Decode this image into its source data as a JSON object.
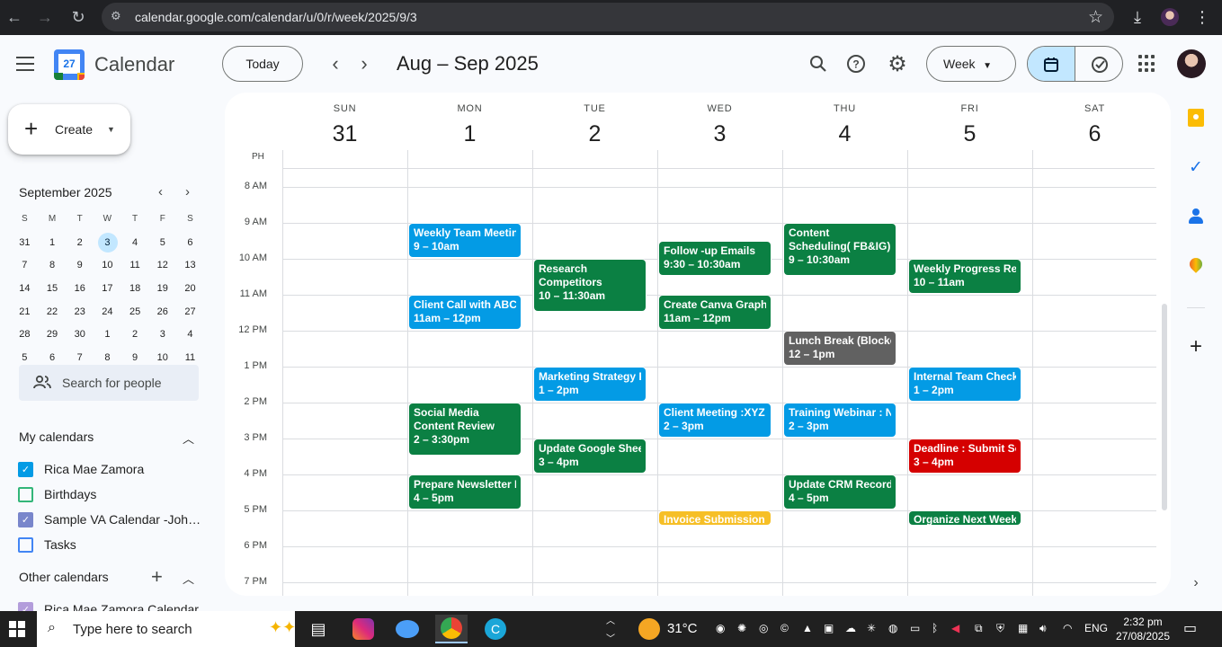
{
  "browser": {
    "url": "calendar.google.com/calendar/u/0/r/week/2025/9/3"
  },
  "header": {
    "app_title": "Calendar",
    "logo_day": "27",
    "today_label": "Today",
    "date_range": "Aug – Sep 2025",
    "view_label": "Week"
  },
  "sidebar": {
    "create_label": "Create",
    "mini_title": "September 2025",
    "mini_days": [
      "S",
      "M",
      "T",
      "W",
      "T",
      "F",
      "S"
    ],
    "mini_weeks": [
      [
        "31",
        "1",
        "2",
        "3",
        "4",
        "5",
        "6"
      ],
      [
        "7",
        "8",
        "9",
        "10",
        "11",
        "12",
        "13"
      ],
      [
        "14",
        "15",
        "16",
        "17",
        "18",
        "19",
        "20"
      ],
      [
        "21",
        "22",
        "23",
        "24",
        "25",
        "26",
        "27"
      ],
      [
        "28",
        "29",
        "30",
        "1",
        "2",
        "3",
        "4"
      ],
      [
        "5",
        "6",
        "7",
        "8",
        "9",
        "10",
        "11"
      ]
    ],
    "search_people_placeholder": "Search for people",
    "my_calendars_title": "My calendars",
    "my_calendars": [
      {
        "name": "Rica Mae Zamora",
        "checked": true,
        "color": "#039be5"
      },
      {
        "name": "Birthdays",
        "checked": false,
        "color": "#33b679"
      },
      {
        "name": "Sample VA Calendar -Johnson",
        "checked": true,
        "color": "#7986cb"
      },
      {
        "name": "Tasks",
        "checked": false,
        "color": "#4285f4"
      }
    ],
    "other_calendars_title": "Other calendars",
    "other_calendars": [
      {
        "name": "Rica Mae Zamora Calendar",
        "checked": true,
        "color": "#b39ddb"
      }
    ]
  },
  "week": {
    "timezone_label": "PH",
    "days": [
      {
        "name": "SUN",
        "num": "31"
      },
      {
        "name": "MON",
        "num": "1"
      },
      {
        "name": "TUE",
        "num": "2"
      },
      {
        "name": "WED",
        "num": "3"
      },
      {
        "name": "THU",
        "num": "4"
      },
      {
        "name": "FRI",
        "num": "5"
      },
      {
        "name": "SAT",
        "num": "6"
      }
    ],
    "hours": [
      "8 AM",
      "9 AM",
      "10 AM",
      "11 AM",
      "12 PM",
      "1 PM",
      "2 PM",
      "3 PM",
      "4 PM",
      "5 PM",
      "6 PM",
      "7 PM"
    ]
  },
  "events": [
    {
      "day": 1,
      "start": 9,
      "end": 10,
      "title": "Weekly Team Meeting",
      "time": "9 – 10am",
      "color": "#039be5"
    },
    {
      "day": 1,
      "start": 11,
      "end": 12,
      "title": "Client Call with ABC Co",
      "time": "11am – 12pm",
      "color": "#039be5"
    },
    {
      "day": 1,
      "start": 14,
      "end": 15.5,
      "title": "Social Media Content Review",
      "time": "2 – 3:30pm",
      "color": "#0b8043",
      "wrap": true
    },
    {
      "day": 1,
      "start": 16,
      "end": 17,
      "title": "Prepare Newsletter Draft",
      "time": "4 – 5pm",
      "color": "#0b8043"
    },
    {
      "day": 2,
      "start": 10,
      "end": 11.5,
      "title": "Research Competitors",
      "time": "10 – 11:30am",
      "color": "#0b8043",
      "wrap": true
    },
    {
      "day": 2,
      "start": 13,
      "end": 14,
      "title": "Marketing Strategy Plan",
      "time": "1 – 2pm",
      "color": "#039be5"
    },
    {
      "day": 2,
      "start": 15,
      "end": 16,
      "title": "Update Google Sheets",
      "time": "3 – 4pm",
      "color": "#0b8043"
    },
    {
      "day": 3,
      "start": 9.5,
      "end": 10.5,
      "title": "Follow -up Emails",
      "time": "9:30 – 10:30am",
      "color": "#0b8043"
    },
    {
      "day": 3,
      "start": 11,
      "end": 12,
      "title": "Create Canva Graphics",
      "time": "11am – 12pm",
      "color": "#0b8043"
    },
    {
      "day": 3,
      "start": 14,
      "end": 15,
      "title": "Client Meeting :XYZ Ltd",
      "time": "2 – 3pm",
      "color": "#039be5"
    },
    {
      "day": 3,
      "start": 17,
      "end": 17.45,
      "title": "Invoice Submission (",
      "time": "",
      "color": "#f6bf26"
    },
    {
      "day": 4,
      "start": 9,
      "end": 10.5,
      "title": "Content Scheduling( FB&IG)",
      "time": "9 – 10:30am",
      "color": "#0b8043",
      "wrap": true
    },
    {
      "day": 4,
      "start": 12,
      "end": 13,
      "title": "Lunch Break (Blocked)",
      "time": "12 – 1pm",
      "color": "#616161"
    },
    {
      "day": 4,
      "start": 14,
      "end": 15,
      "title": "Training Webinar : New",
      "time": "2 – 3pm",
      "color": "#039be5"
    },
    {
      "day": 4,
      "start": 16,
      "end": 17,
      "title": "Update CRM Records",
      "time": "4 – 5pm",
      "color": "#0b8043"
    },
    {
      "day": 5,
      "start": 10,
      "end": 11,
      "title": "Weekly Progress Report",
      "time": "10 – 11am",
      "color": "#0b8043"
    },
    {
      "day": 5,
      "start": 13,
      "end": 14,
      "title": "Internal Team Check",
      "time": "1 – 2pm",
      "color": "#039be5"
    },
    {
      "day": 5,
      "start": 15,
      "end": 16,
      "title": "Deadline : Submit Social",
      "time": "3 – 4pm",
      "color": "#d50000"
    },
    {
      "day": 5,
      "start": 17,
      "end": 17.45,
      "title": "Organize Next Week's",
      "time": "",
      "color": "#0b8043"
    }
  ],
  "taskbar": {
    "search_placeholder": "Type here to search",
    "temperature": "31°C",
    "language": "ENG",
    "time": "2:32 pm",
    "date": "27/08/2025"
  }
}
